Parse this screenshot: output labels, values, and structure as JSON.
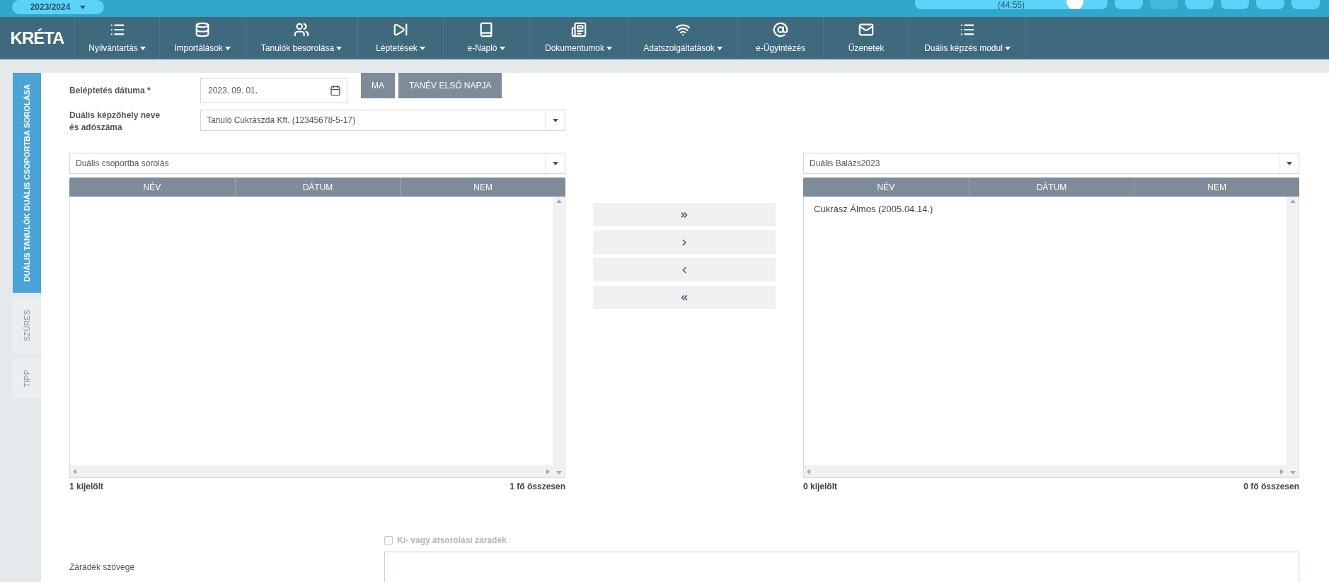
{
  "top_bar": {
    "year_selector": "2023/2024",
    "session_timer": "(44:55)"
  },
  "logo": "KRÉTA",
  "nav": [
    {
      "label": "Nyilvántartás",
      "dropdown": true
    },
    {
      "label": "Importálások",
      "dropdown": true
    },
    {
      "label": "Tanulók besorolása",
      "dropdown": true
    },
    {
      "label": "Léptetések",
      "dropdown": true
    },
    {
      "label": "e-Napló",
      "dropdown": true
    },
    {
      "label": "Dokumentumok",
      "dropdown": true
    },
    {
      "label": "Adatszolgáltatások",
      "dropdown": true
    },
    {
      "label": "e-Ügyintézés",
      "dropdown": false
    },
    {
      "label": "Üzenetek",
      "dropdown": false
    },
    {
      "label": "Duális képzés modul",
      "dropdown": true
    }
  ],
  "side_tabs": [
    {
      "label": "DUÁLIS TANULÓK DUÁLIS CSOPORTBA SOROLÁSA",
      "selected": true
    },
    {
      "label": "SZŰRÉS",
      "selected": false
    },
    {
      "label": "TIPP",
      "selected": false
    }
  ],
  "form": {
    "date_label": "Beléptetés dátuma *",
    "date_value": "2023. 09. 01.",
    "buttons": [
      "MA",
      "TANÉV ELSŐ NAPJA"
    ],
    "workplace_label": "Duális képzőhely neve és adószáma",
    "workplace_value": "Tanuló Cukrászda Kft. (12345678-5-17)"
  },
  "lists": [
    {
      "group": "Duális csoportba sorolás",
      "columns": [
        "NÉV",
        "DÁTUM",
        "NEM"
      ],
      "selected_count": "1 kijelölt",
      "total": "1 fő összesen"
    },
    {
      "group": "Duális Balázs2023",
      "columns": [
        "NÉV",
        "DÁTUM",
        "NEM"
      ],
      "rows": [
        "Cukrász Álmos (2005.04.14.)"
      ],
      "selected_count": "0 kijelölt",
      "total": "0 fő összesen"
    }
  ],
  "move_buttons": [
    {
      "kind": "all_right"
    },
    {
      "kind": "right"
    },
    {
      "kind": "left"
    },
    {
      "kind": "all_left"
    }
  ],
  "clause": {
    "checkbox_label": "Ki- vagy átsorolási záradék",
    "checked": false,
    "disabled": true,
    "text_label": "Záradék szövege"
  }
}
